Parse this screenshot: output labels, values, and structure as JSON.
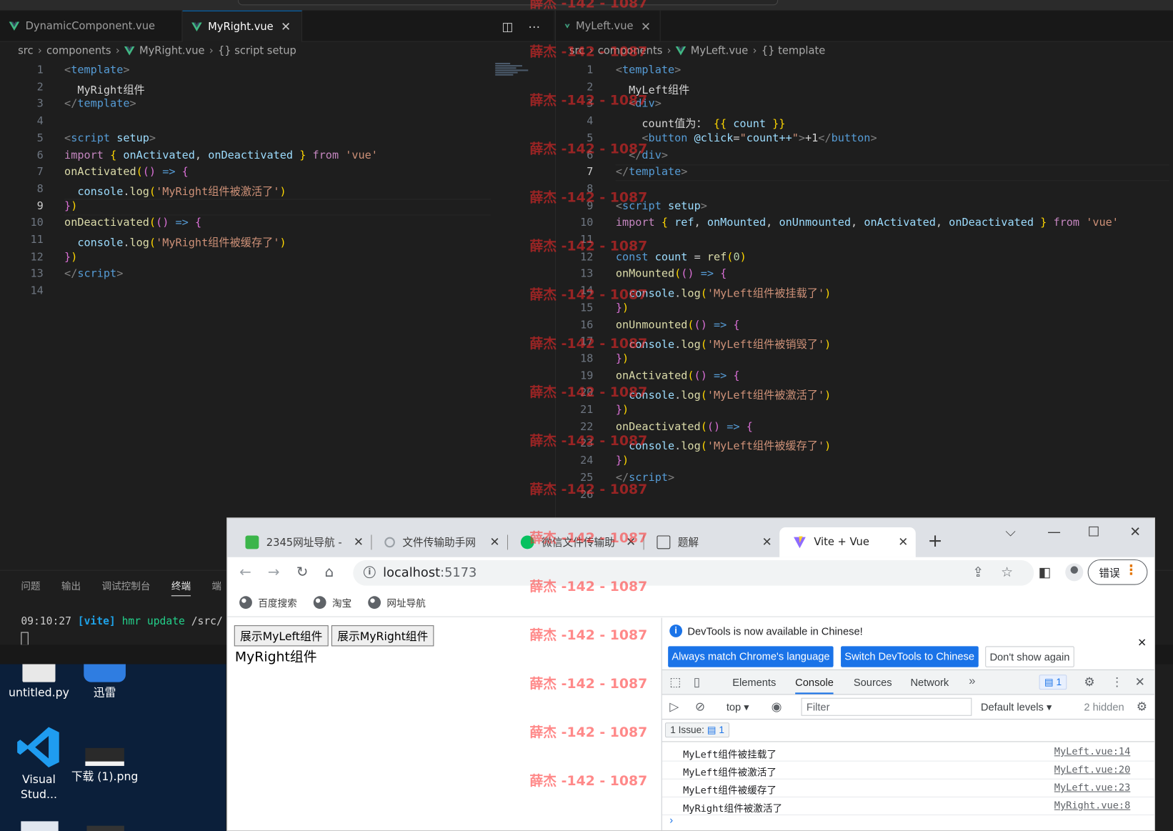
{
  "watermark": "薛杰 -142 - 1087",
  "editor_left": {
    "tabs": [
      {
        "label": "DynamicComponent.vue"
      },
      {
        "label": "MyRight.vue"
      }
    ],
    "close_glyph": "✕",
    "breadcrumb": [
      "src",
      "components",
      "MyRight.vue",
      "{} script setup"
    ],
    "line_numbers": [
      "1",
      "2",
      "3",
      "4",
      "5",
      "6",
      "7",
      "8",
      "9",
      "10",
      "11",
      "12",
      "13",
      "14"
    ],
    "current_line": 9
  },
  "editor_right": {
    "tabs": [
      {
        "label": "MyLeft.vue"
      }
    ],
    "breadcrumb": [
      "src",
      "components",
      "MyLeft.vue",
      "{} template"
    ],
    "line_numbers": [
      "1",
      "2",
      "3",
      "4",
      "5",
      "6",
      "7",
      "8",
      "9",
      "10",
      "11",
      "12",
      "13",
      "14",
      "15",
      "16",
      "17",
      "18",
      "19",
      "20",
      "21",
      "22",
      "23",
      "24",
      "25",
      "26"
    ],
    "current_line": 7
  },
  "panel": {
    "tabs": [
      "问题",
      "输出",
      "调试控制台",
      "终端",
      "端"
    ],
    "terminal": {
      "time": "09:10:27",
      "tag": "[vite]",
      "msg": "hmr update",
      "path": "/src/"
    }
  },
  "desktop": {
    "icons": [
      "untitled.py",
      "迅雷",
      "Visual Stud...",
      "下载 (1).png"
    ]
  },
  "browser": {
    "tabs": [
      {
        "label": "2345网址导航 -"
      },
      {
        "label": "文件传输助手网"
      },
      {
        "label": "微信文件传输助"
      },
      {
        "label": "题解"
      },
      {
        "label": "Vite + Vue"
      }
    ],
    "url_host": "localhost",
    "url_port": ":5173",
    "error_button": "错误",
    "bookmarks": [
      "百度搜索",
      "淘宝",
      "网址导航"
    ],
    "page": {
      "button_left": "展示MyLeft组件",
      "button_right": "展示MyRight组件",
      "text": "MyRight组件"
    }
  },
  "devtools": {
    "info_message": "DevTools is now available in Chinese!",
    "info_buttons": [
      "Always match Chrome's language",
      "Switch DevTools to Chinese",
      "Don't show again"
    ],
    "tabs": [
      "Elements",
      "Console",
      "Sources",
      "Network"
    ],
    "issues_badge": "1",
    "context": "top",
    "filter_placeholder": "Filter",
    "levels": "Default levels",
    "hidden": "2 hidden",
    "issues_label": "1 Issue:",
    "issues_count": "1",
    "logs": [
      {
        "msg": "MyLeft组件被挂载了",
        "src": "MyLeft.vue:14"
      },
      {
        "msg": "MyLeft组件被激活了",
        "src": "MyLeft.vue:20"
      },
      {
        "msg": "MyLeft组件被缓存了",
        "src": "MyLeft.vue:23"
      },
      {
        "msg": "MyRight组件被激活了",
        "src": "MyRight.vue:8"
      }
    ]
  },
  "colors": {
    "vue_green": "#41b883",
    "accent": "#0078d4",
    "chrome_blue": "#1a73e8"
  }
}
